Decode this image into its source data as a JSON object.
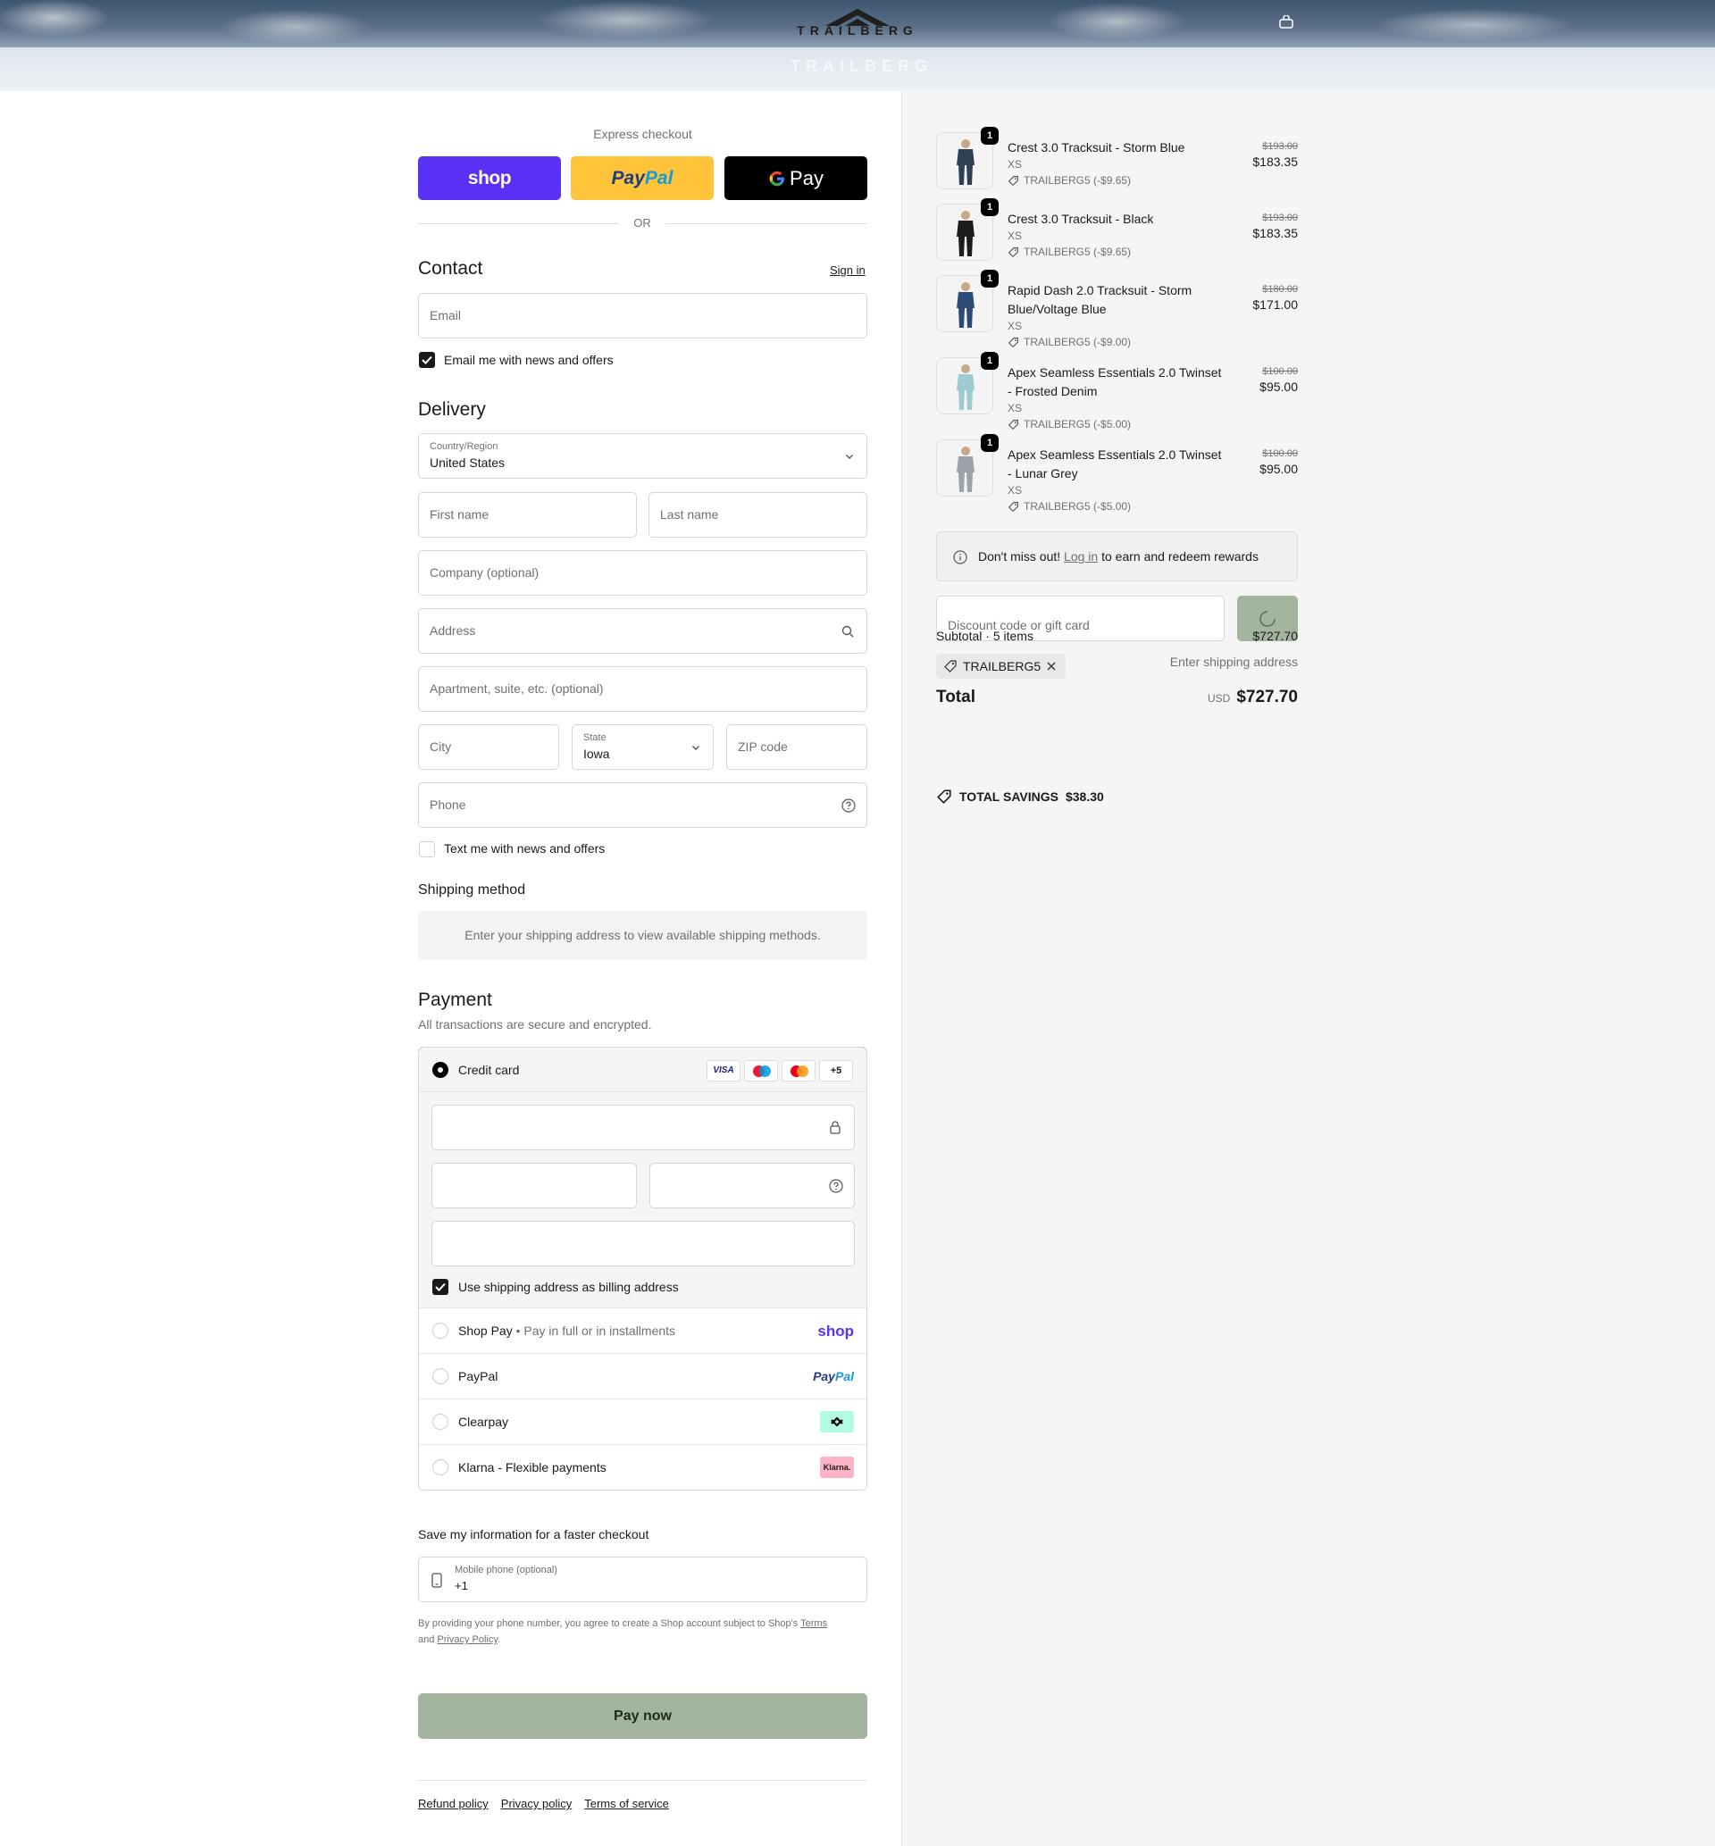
{
  "header": {
    "brand": "TRAILBERG"
  },
  "express": {
    "title": "Express checkout",
    "shop_label": "shop",
    "paypal_label_a": "Pay",
    "paypal_label_b": "Pal",
    "gpay_label": "Pay",
    "or_label": "OR"
  },
  "contact": {
    "heading": "Contact",
    "sign_in": "Sign in",
    "email_placeholder": "Email",
    "news_label": "Email me with news and offers",
    "news_checked": true
  },
  "delivery": {
    "heading": "Delivery",
    "country_label": "Country/Region",
    "country_value": "United States",
    "first_name": "First name",
    "last_name": "Last name",
    "company": "Company (optional)",
    "address": "Address",
    "apartment": "Apartment, suite, etc. (optional)",
    "city": "City",
    "state_label": "State",
    "state_value": "Iowa",
    "zip": "ZIP code",
    "phone": "Phone",
    "sms_label": "Text me with news and offers",
    "sms_checked": false
  },
  "shipping": {
    "heading": "Shipping method",
    "notice": "Enter your shipping address to view available shipping methods."
  },
  "payment": {
    "heading": "Payment",
    "subtitle": "All transactions are secure and encrypted.",
    "credit_card_label": "Credit card",
    "card_more": "+5",
    "visa_label": "VISA",
    "billing_label": "Use shipping address as billing address",
    "billing_checked": true,
    "methods": [
      {
        "label": "Shop Pay",
        "sub": "Pay in full or in installments",
        "logo": "shop"
      },
      {
        "label": "PayPal",
        "logo_a": "Pay",
        "logo_b": "Pal"
      },
      {
        "label": "Clearpay"
      },
      {
        "label": "Klarna - Flexible payments",
        "logo": "Klarna."
      }
    ]
  },
  "save_info": {
    "heading": "Save my information for a faster checkout",
    "mobile_label": "Mobile phone (optional)",
    "mobile_value": "+1",
    "legal_a": "By providing your phone number, you agree to create a Shop account subject to Shop's ",
    "terms_link": "Terms",
    "legal_b": "and ",
    "privacy_link": "Privacy Policy",
    "legal_c": "."
  },
  "pay_now": "Pay now",
  "footer_links": [
    "Refund policy",
    "Privacy policy",
    "Terms of service"
  ],
  "cart": {
    "items": [
      {
        "qty": "1",
        "name": "Crest 3.0 Tracksuit - Storm Blue",
        "variant": "XS",
        "discount": "TRAILBERG5 (-$9.65)",
        "old_price": "$193.00",
        "price": "$183.35",
        "color": "#2f3f55"
      },
      {
        "qty": "1",
        "name": "Crest 3.0 Tracksuit - Black",
        "variant": "XS",
        "discount": "TRAILBERG5 (-$9.65)",
        "old_price": "$193.00",
        "price": "$183.35",
        "color": "#1c1c1c"
      },
      {
        "qty": "1",
        "name": "Rapid Dash 2.0 Tracksuit - Storm Blue/Voltage Blue",
        "variant": "XS",
        "discount": "TRAILBERG5 (-$9.00)",
        "old_price": "$180.00",
        "price": "$171.00",
        "color": "#2c4a78"
      },
      {
        "qty": "1",
        "name": "Apex Seamless Essentials 2.0 Twinset - Frosted Denim",
        "variant": "XS",
        "discount": "TRAILBERG5 (-$5.00)",
        "old_price": "$100.00",
        "price": "$95.00",
        "color": "#9ecbd2"
      },
      {
        "qty": "1",
        "name": "Apex Seamless Essentials 2.0 Twinset - Lunar Grey",
        "variant": "XS",
        "discount": "TRAILBERG5 (-$5.00)",
        "old_price": "$100.00",
        "price": "$95.00",
        "color": "#9aa3a8"
      }
    ],
    "rewards_a": "Don't miss out! ",
    "rewards_link": "Log in",
    "rewards_b": " to earn and redeem rewards",
    "discount_placeholder": "Discount code or gift card",
    "subtotal_label": "Subtotal · 5 items",
    "subtotal_value": "$727.70",
    "code_tag": "TRAILBERG5",
    "shipping_note": "Enter shipping address",
    "total_label": "Total",
    "total_currency": "USD",
    "total_value": "$727.70",
    "savings_label": "TOTAL SAVINGS",
    "savings_value": "$38.30"
  },
  "colors": {
    "shop_purple": "#5a31f4",
    "paypal_yellow": "#ffc439",
    "pay_now_green": "#a4b59f",
    "apply_green": "#a4b59f"
  }
}
